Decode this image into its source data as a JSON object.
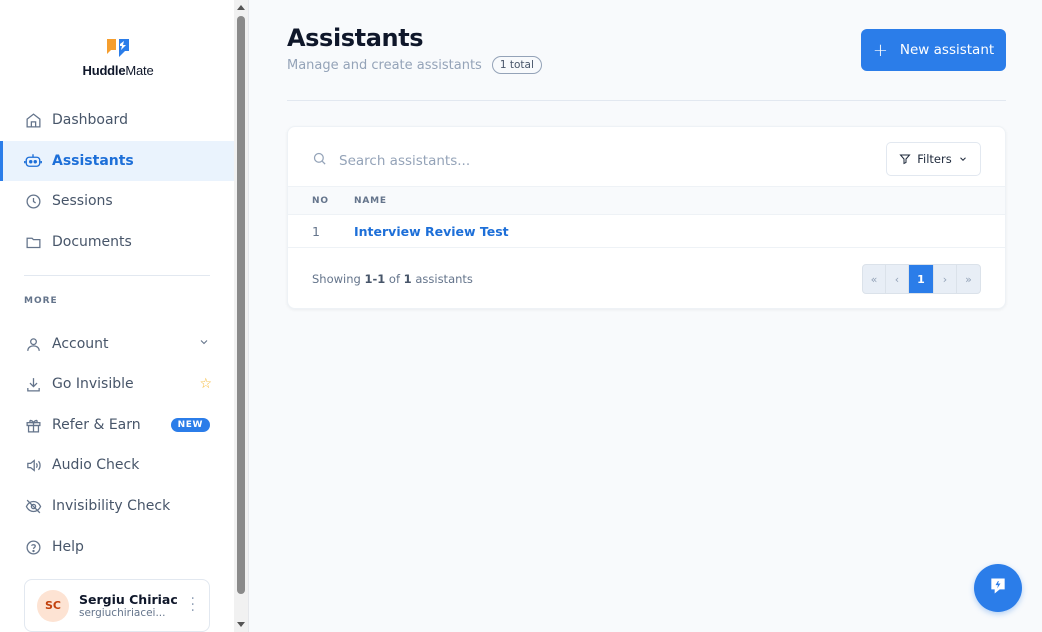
{
  "app": {
    "logo_prefix": "Huddle",
    "logo_suffix": "Mate"
  },
  "nav": {
    "primary": [
      {
        "label": "Dashboard",
        "icon": "home-icon"
      },
      {
        "label": "Assistants",
        "icon": "robot-icon",
        "active": true
      },
      {
        "label": "Sessions",
        "icon": "clock-icon"
      },
      {
        "label": "Documents",
        "icon": "folder-icon"
      }
    ],
    "more_label": "MORE",
    "secondary": [
      {
        "label": "Account",
        "icon": "user-icon"
      },
      {
        "label": "Go Invisible",
        "icon": "download-icon"
      },
      {
        "label": "Refer & Earn",
        "icon": "gift-icon",
        "badge": "NEW"
      },
      {
        "label": "Audio Check",
        "icon": "speaker-icon"
      },
      {
        "label": "Invisibility Check",
        "icon": "eye-off-icon"
      },
      {
        "label": "Help",
        "icon": "help-icon"
      }
    ]
  },
  "user": {
    "initials": "SC",
    "name": "Sergiu Chiriac",
    "email": "sergiuchiriacei..."
  },
  "header": {
    "title": "Assistants",
    "subtitle": "Manage and create assistants",
    "count_badge": "1 total",
    "new_button": "New assistant"
  },
  "search": {
    "placeholder": "Search assistants..."
  },
  "filters": {
    "label": "Filters"
  },
  "table": {
    "columns": [
      "NO",
      "NAME"
    ],
    "rows": [
      {
        "no": "1",
        "name": "Interview Review Test"
      }
    ]
  },
  "footer": {
    "showing_prefix": "Showing",
    "range": "1-1",
    "of": "of",
    "total": "1",
    "suffix": "assistants"
  },
  "pagination": {
    "first": "«",
    "prev": "‹",
    "current": "1",
    "next": "›",
    "last": "»"
  },
  "colors": {
    "accent": "#2b7de9",
    "active_bg": "#eaf3fd",
    "star": "#f5b731"
  }
}
